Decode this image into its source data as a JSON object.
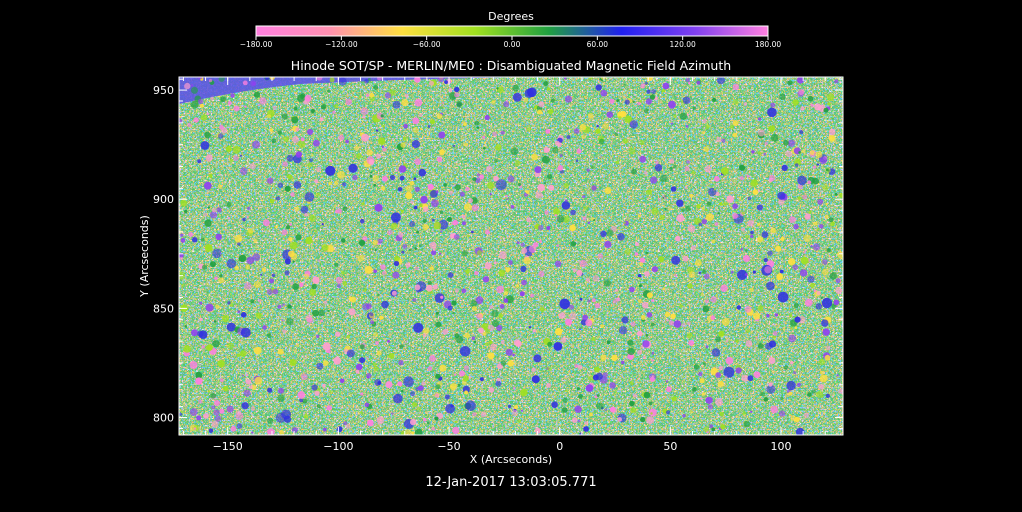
{
  "chart_data": {
    "type": "heatmap",
    "title": "Hinode SOT/SP - MERLIN/ME0 : Disambiguated Magnetic Field Azimuth",
    "xlabel": "X (Arcseconds)",
    "ylabel": "Y (Arcseconds)",
    "xlim": [
      -172,
      128
    ],
    "ylim": [
      792,
      956
    ],
    "x_ticks": [
      -150,
      -100,
      -50,
      0,
      50,
      100
    ],
    "x_tick_labels": [
      "−150",
      "−100",
      "−50",
      "0",
      "50",
      "100"
    ],
    "y_ticks": [
      800,
      850,
      900,
      950
    ],
    "y_tick_labels": [
      "800",
      "850",
      "900",
      "950"
    ],
    "colorbar": {
      "title": "Degrees",
      "range": [
        -180,
        180
      ],
      "ticks": [
        -180,
        -120,
        -60,
        0,
        60,
        120,
        180
      ],
      "tick_labels": [
        "−180.00",
        "−120.00",
        "−60.00",
        "0.00",
        "60.00",
        "120.00",
        "180.00"
      ],
      "colors": [
        "#ff80e0",
        "#ff90b0",
        "#ffe040",
        "#a0e020",
        "#20a040",
        "#2020f0",
        "#8040f0",
        "#ff80e0"
      ]
    },
    "timestamp": "12-Jan-2017 13:03:05.771",
    "grid": false
  }
}
